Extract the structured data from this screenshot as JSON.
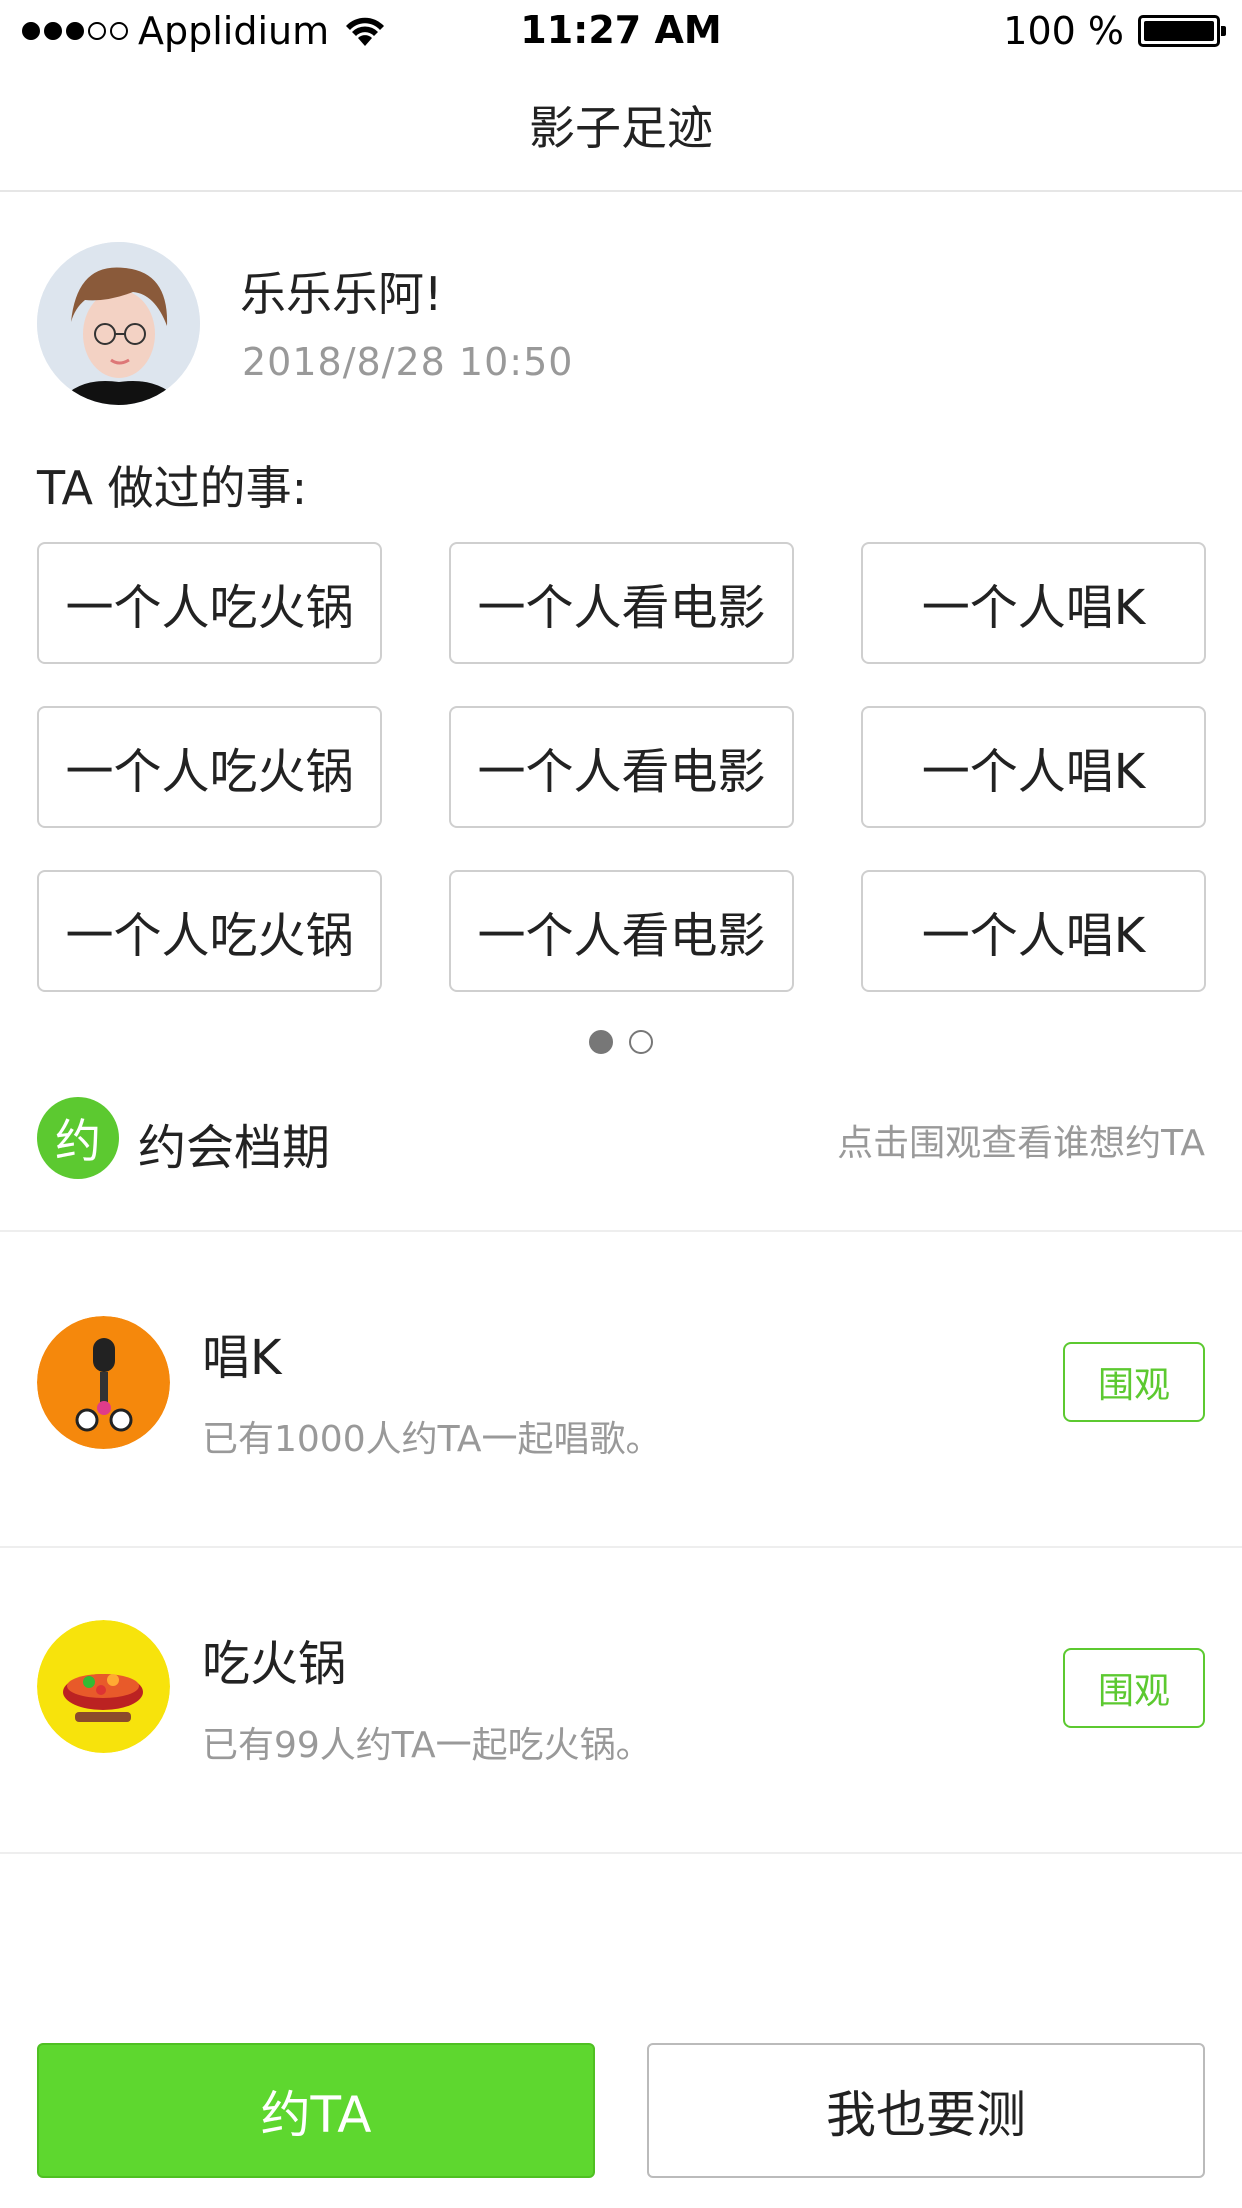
{
  "status_bar": {
    "carrier": "Applidium",
    "time": "11:27 AM",
    "battery": "100 %",
    "icons": [
      "signal-dots-icon",
      "wifi-icon",
      "battery-icon"
    ]
  },
  "nav": {
    "title": "影子足迹"
  },
  "profile": {
    "name": "乐乐乐阿!",
    "timestamp": "2018/8/28   10:50"
  },
  "did_things": {
    "label": "TA 做过的事:",
    "tags": [
      "一个人吃火锅",
      "一个人看电影",
      "一个人唱K",
      "一个人吃火锅",
      "一个人看电影",
      "一个人唱K",
      "一个人吃火锅",
      "一个人看电影",
      "一个人唱K"
    ],
    "pager": {
      "pages": 2,
      "current": 1
    }
  },
  "dating": {
    "icon_char": "约",
    "title": "约会档期",
    "hint": "点击围观查看谁想约TA",
    "items": [
      {
        "title": "唱K",
        "desc": "已有1000人约TA一起唱歌。",
        "button": "围观",
        "icon": "microphone-icon",
        "icon_bg": "#f5880c"
      },
      {
        "title": "吃火锅",
        "desc": "已有99人约TA一起吃火锅。",
        "button": "围观",
        "icon": "hotpot-icon",
        "icon_bg": "#f7e30c"
      }
    ]
  },
  "actions": {
    "primary": "约TA",
    "secondary": "我也要测"
  },
  "colors": {
    "accent": "#5cc930",
    "primary_button": "#5ed72f"
  }
}
